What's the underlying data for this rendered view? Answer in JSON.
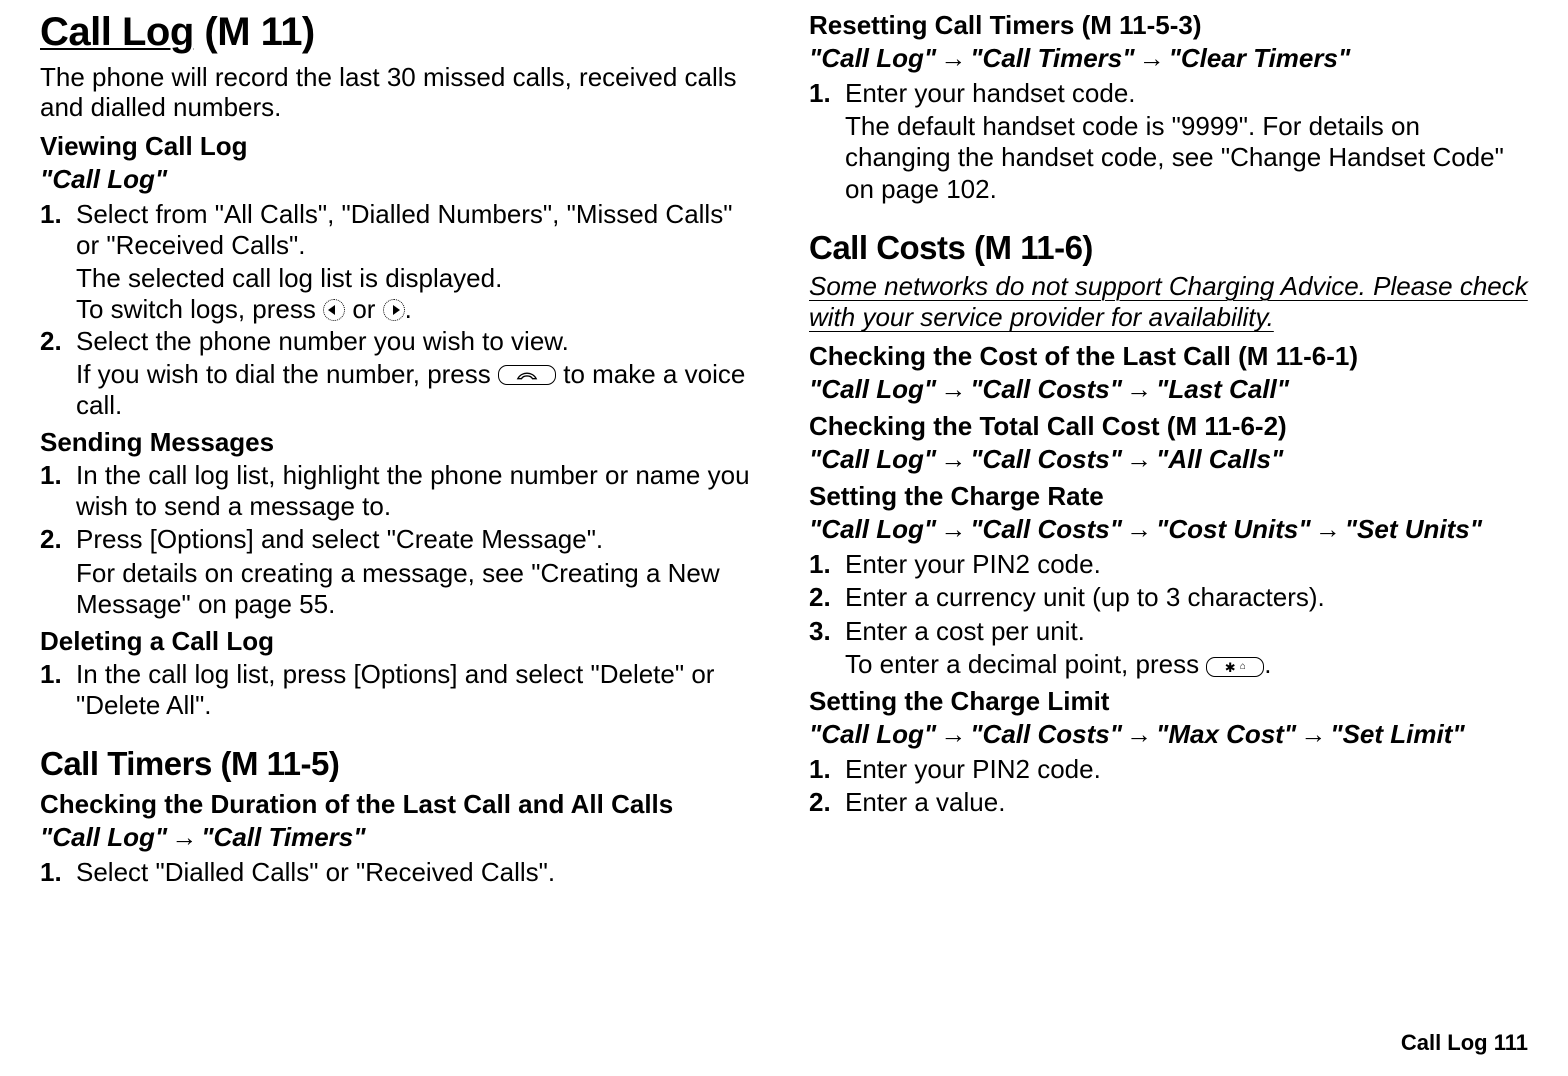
{
  "left": {
    "main_title_1": "Call Log",
    "main_title_2": " (M 11)",
    "intro": "The phone will record the last 30 missed calls, received calls and dialled numbers.",
    "viewing_heading": "Viewing Call Log",
    "viewing_nav": "\"Call Log\"",
    "viewing_step1": "Select from \"All Calls\", \"Dialled Numbers\", \"Missed Calls\" or \"Received Calls\".",
    "viewing_step1_sub1": "The selected call log list is displayed.",
    "viewing_step1_sub2a": "To switch logs, press ",
    "viewing_step1_sub2b": " or ",
    "viewing_step1_sub2c": ".",
    "viewing_step2": "Select the phone number you wish to view.",
    "viewing_step2_sub_a": "If you wish to dial the number, press ",
    "viewing_step2_sub_b": " to make a voice call.",
    "sending_heading": "Sending Messages",
    "sending_step1": "In the call log list, highlight the phone number or name you wish to send a message to.",
    "sending_step2": "Press [Options] and select \"Create Message\".",
    "sending_step2_sub": "For details on creating a message, see \"Creating a New Message\" on page 55.",
    "deleting_heading": "Deleting a Call Log",
    "deleting_step1": "In the call log list, press [Options] and select \"Delete\" or \"Delete All\".",
    "timers_heading": "Call Timers ",
    "timers_code": "(M 11-5)",
    "checking_heading": "Checking the Duration of the Last Call and All Calls",
    "checking_nav_a": "\"Call Log\"",
    "checking_nav_b": "\"Call Timers\"",
    "checking_step1": "Select \"Dialled Calls\" or \"Received Calls\"."
  },
  "right": {
    "reset_heading": "Resetting Call Timers ",
    "reset_code": "(M 11-5-3)",
    "reset_nav_a": "\"Call Log\"",
    "reset_nav_b": "\"Call Timers\"",
    "reset_nav_c": "\"Clear Timers\"",
    "reset_step1": "Enter your handset code.",
    "reset_step1_sub": "The default handset code is \"9999\". For details on changing the handset code, see \"Change Handset Code\" on page 102.",
    "costs_heading": "Call Costs ",
    "costs_code": "(M 11-6)",
    "costs_note": "Some networks do not support Charging Advice. Please check with your service provider for availability.",
    "lastcall_heading": "Checking the Cost of the Last Call ",
    "lastcall_code": "(M 11-6-1)",
    "lastcall_nav_a": "\"Call Log\"",
    "lastcall_nav_b": "\"Call Costs\"",
    "lastcall_nav_c": "\"Last Call\"",
    "total_heading": "Checking the Total Call Cost ",
    "total_code": "(M 11-6-2)",
    "total_nav_a": "\"Call Log\"",
    "total_nav_b": "\"Call Costs\"",
    "total_nav_c": "\"All Calls\"",
    "rate_heading": "Setting the Charge Rate",
    "rate_nav_a": "\"Call Log\"",
    "rate_nav_b": "\"Call Costs\"",
    "rate_nav_c": "\"Cost Units\"",
    "rate_nav_d": "\"Set Units\"",
    "rate_step1": "Enter your PIN2 code.",
    "rate_step2": "Enter a currency unit (up to 3 characters).",
    "rate_step3": "Enter a cost per unit.",
    "rate_step3_sub_a": "To enter a decimal point, press ",
    "rate_step3_sub_b": ".",
    "star_key": "P",
    "limit_heading": "Setting the Charge Limit",
    "limit_nav_a": "\"Call Log\"",
    "limit_nav_b": "\"Call Costs\"",
    "limit_nav_c": "\"Max Cost\"",
    "limit_nav_d": "\"Set Limit\"",
    "limit_step1": "Enter your PIN2 code.",
    "limit_step2": "Enter a value."
  },
  "footer": "Call Log  111",
  "nums": {
    "n1": "1.",
    "n2": "2.",
    "n3": "3."
  }
}
